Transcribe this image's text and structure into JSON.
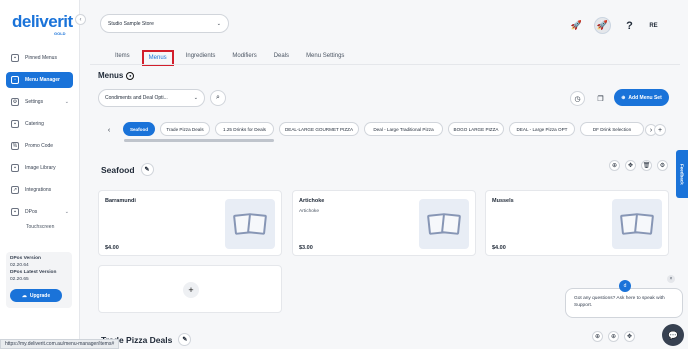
{
  "brand": {
    "logo": "deliverit",
    "logo_sub": "GOLD"
  },
  "sidebar": {
    "items": [
      {
        "label": "Pinned Menus",
        "icon": "pin-icon"
      },
      {
        "label": "Menu Manager",
        "icon": "menu-manager-icon",
        "active": true
      },
      {
        "label": "Settings",
        "icon": "gear-icon"
      },
      {
        "label": "Catering",
        "icon": "catering-icon"
      },
      {
        "label": "Promo Code",
        "icon": "promo-icon"
      },
      {
        "label": "Image Library",
        "icon": "image-icon"
      },
      {
        "label": "Integrations",
        "icon": "integrations-icon"
      },
      {
        "label": "DPos",
        "icon": "dpos-icon"
      }
    ],
    "sub_item": "Touchscreen",
    "version": {
      "dpos_label": "DPos Version",
      "dpos_value": "02.20.64",
      "latest_label": "DPos Latest Version",
      "latest_value": "02.20.65"
    },
    "upgrade_label": "Upgrade"
  },
  "header": {
    "store": "Studio Sample Store",
    "avatar_initials": "RE"
  },
  "tabs": [
    "Items",
    "Menus",
    "Ingredients",
    "Modifiers",
    "Deals",
    "Menu Settings"
  ],
  "active_tab": "Menus",
  "menus_title": "Menus",
  "category_select": "Condiments and Deal Opti...",
  "add_menu_label": "Add Menu Set",
  "chips": [
    "Seafood",
    "Trade Pizza Deals",
    "1.25 Drinks for Deals",
    "DEAL-LARGE GOURMET PIZZA",
    "Deal - Large Traditional Pizza",
    "BOGO LARGE PIZZA",
    "DEAL - Large Pizza OPT",
    "DF Drink Selection"
  ],
  "sections": [
    {
      "title": "Seafood",
      "items": [
        {
          "name": "Barramundi",
          "desc": "",
          "price": "$4.00"
        },
        {
          "name": "Artichoke",
          "desc": "Artichoke",
          "price": "$3.00"
        },
        {
          "name": "Mussels",
          "desc": "",
          "price": "$4.00"
        }
      ]
    },
    {
      "title": "Trade Pizza Deals"
    }
  ],
  "feedback_label": "Feedback",
  "chat": {
    "message": "Got any questions? Ask here to speak with Support."
  },
  "status_url": "https://my.deliverit.com.au/menu-manager/items#",
  "colors": {
    "accent": "#1a73d9",
    "highlight": "#d21f2c"
  }
}
